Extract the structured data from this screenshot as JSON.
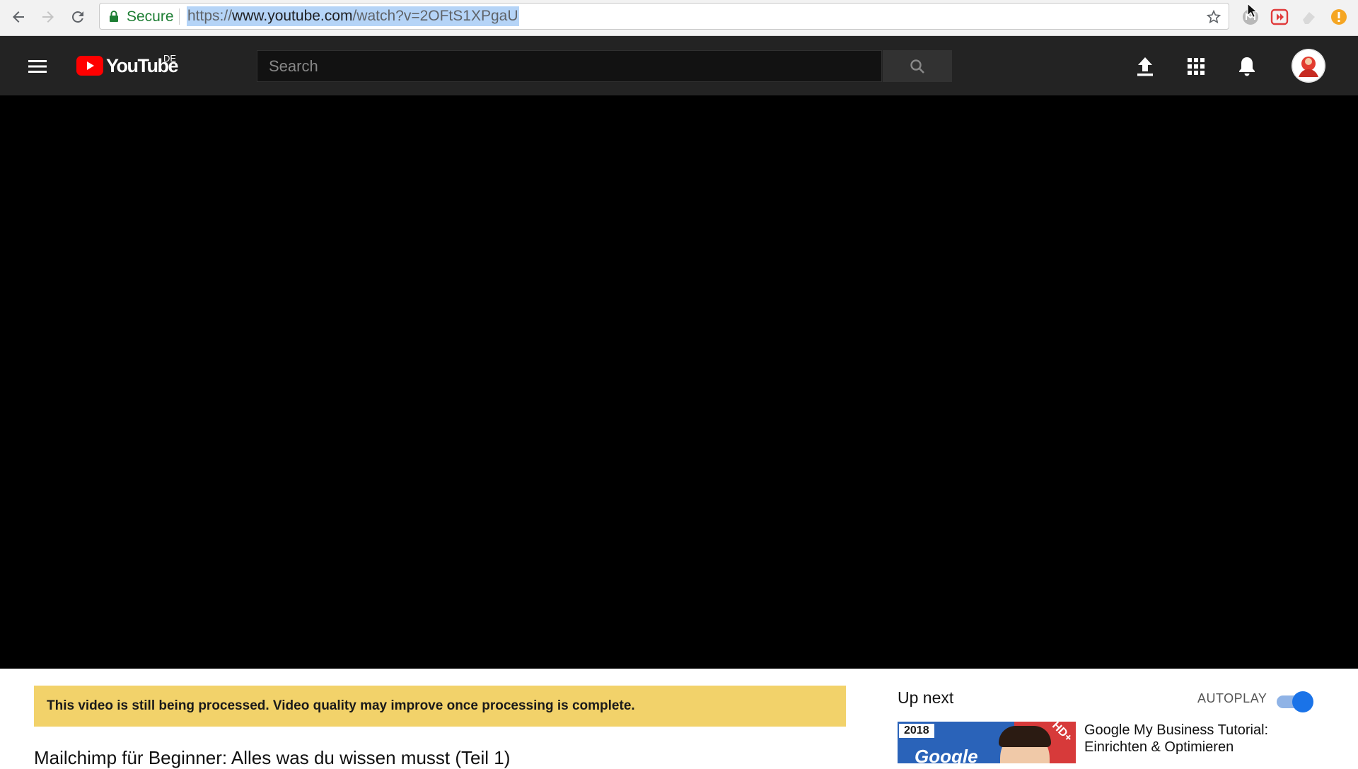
{
  "browser": {
    "secure_label": "Secure",
    "url_scheme": "https://",
    "url_host": "www.youtube.com",
    "url_path": "/watch?v=2OFtS1XPgaU"
  },
  "header": {
    "logo_text": "YouTube",
    "country_code": "DE",
    "search_placeholder": "Search",
    "icons": [
      "menu-icon",
      "upload-icon",
      "apps-icon",
      "notifications-icon",
      "avatar"
    ]
  },
  "player": {
    "background": "#000000"
  },
  "main": {
    "processing_notice": "This video is still being processed. Video quality may improve once processing is complete.",
    "video_title": "Mailchimp für Beginner: Alles was du wissen musst (Teil 1)"
  },
  "sidebar": {
    "up_next_label": "Up next",
    "autoplay_label": "AUTOPLAY",
    "autoplay_on": true,
    "next_video": {
      "thumbnail_year": "2018",
      "thumbnail_text": "Google",
      "thumbnail_badge": "HD+",
      "title": "Google My Business Tutorial: Einrichten & Optimieren"
    }
  },
  "colors": {
    "header_bg": "#232323",
    "notice_bg": "#f2d26a",
    "brand_red": "#ff0000",
    "toggle_blue": "#1a73e8"
  }
}
